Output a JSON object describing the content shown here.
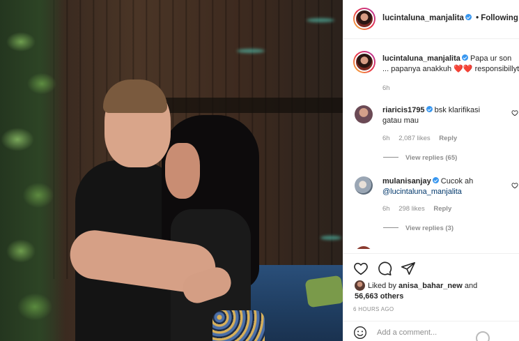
{
  "post_header": {
    "username": "lucintaluna_manjalita",
    "separator": "•",
    "follow_status": "Following"
  },
  "caption": {
    "username": "lucintaluna_manjalita",
    "text_line1": "Papa ur son",
    "text_line2": "... papanya anakkuh ❤️❤️ responsibillyty",
    "time": "6h"
  },
  "comments": [
    {
      "username": "riaricis1795",
      "text": "bsk klarifikasi",
      "text_line2": "gatau mau",
      "time": "6h",
      "likes": "2,087 likes",
      "reply": "Reply",
      "view_replies": "View replies (65)"
    },
    {
      "username": "mulanisanjay",
      "text": "Cucok ah",
      "text_line2": "@lucintaluna_manjalita",
      "time": "6h",
      "likes": "298 likes",
      "reply": "Reply",
      "view_replies": "View replies (3)"
    }
  ],
  "likes": {
    "prefix": "Liked by",
    "user": "anisa_bahar_new",
    "conjunction": "and",
    "others": "56,663 others"
  },
  "posted_ago": "6 HOURS AGO",
  "add_comment": {
    "placeholder": "Add a comment..."
  },
  "colors": {
    "verified": "#3897f0",
    "muted_text": "#8e8e8e",
    "primary_text": "#262626"
  }
}
